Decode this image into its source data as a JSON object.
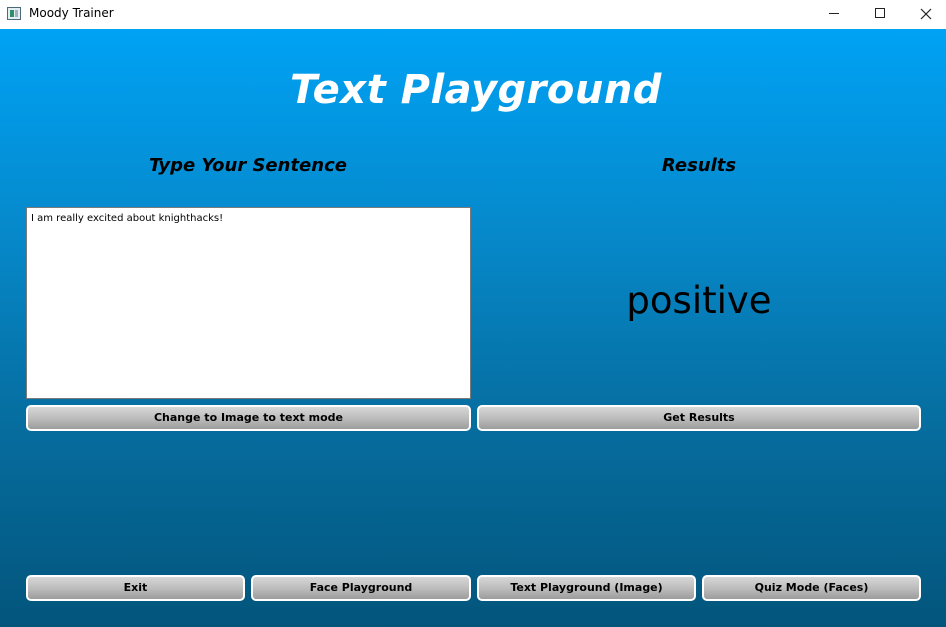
{
  "window": {
    "title": "Moody Trainer"
  },
  "page": {
    "title": "Text Playground",
    "left_heading": "Type Your Sentence",
    "right_heading": "Results"
  },
  "sentence_input": {
    "value": "I am really excited about knighthacks!"
  },
  "result": {
    "label": "positive"
  },
  "buttons": {
    "change_mode": "Change to Image to text mode",
    "get_results": "Get Results",
    "exit": "Exit",
    "face_playground": "Face Playground",
    "text_playground_image": "Text Playground (Image)",
    "quiz_mode": "Quiz Mode (Faces)"
  },
  "icons": {
    "app": "app-icon",
    "minimize": "minimize-icon",
    "maximize": "maximize-icon",
    "close": "close-icon"
  },
  "colors": {
    "background_top": "#00a2f5",
    "background_bottom": "#03557c",
    "title_text": "#ffffff",
    "button_face": "#bdbdbd"
  }
}
